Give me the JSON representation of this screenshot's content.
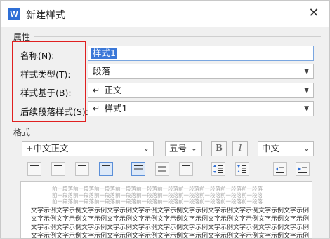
{
  "window": {
    "title": "新建样式",
    "app_icon": "W"
  },
  "properties": {
    "section_label": "属性",
    "name": {
      "label": "名称(N):",
      "value": "样式1"
    },
    "style_type": {
      "label": "样式类型(T):",
      "value": "段落"
    },
    "based_on": {
      "label": "样式基于(B):",
      "value": "正文"
    },
    "next_style": {
      "label": "后续段落样式(S):",
      "value": "样式1"
    }
  },
  "format": {
    "section_label": "格式",
    "font": "+中文正文",
    "size": "五号",
    "bold": "B",
    "italic": "I",
    "lang": "中文"
  },
  "preview": {
    "prev_line": "前一段落前一段落前一段落前一段落前一段落前一段落前一段落前一段落前一段落前一段落",
    "sample_line": "文字示例文字示例文字示例文字示例文字示例文字示例文字示例文字示例文字示例文字示例文字示例"
  },
  "colors": {
    "highlight": "#e02020",
    "selection": "#3b78d8"
  }
}
